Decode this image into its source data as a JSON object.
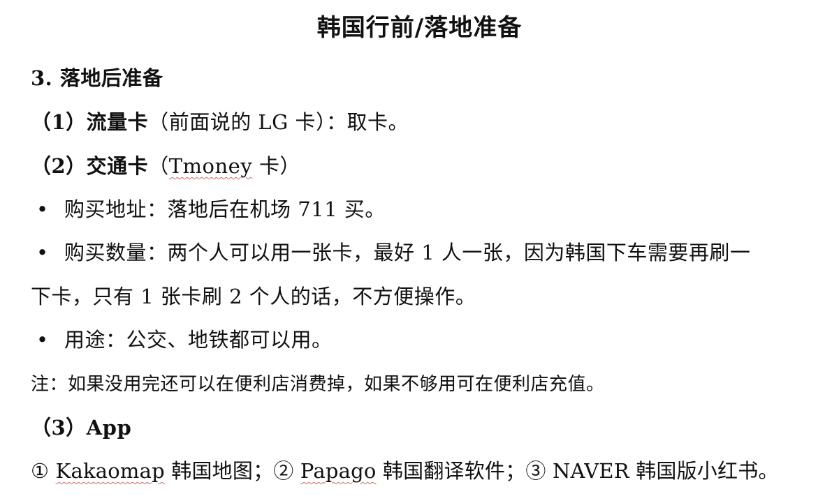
{
  "title": "韩国行前/落地准备",
  "section": {
    "heading": "3. 落地后准备"
  },
  "item1": {
    "label": "（1）流量卡",
    "rest": "（前面说的 LG 卡）：取卡。"
  },
  "item2": {
    "label": "（2）交通卡",
    "paren_open": "（",
    "term": "Tmoney",
    "paren_close": " 卡）"
  },
  "bullets": {
    "symbol": "•",
    "b1": "购买地址：落地后在机场 711 买。",
    "b2_line1": "购买数量：两个人可以用一张卡，最好 1 人一张，因为韩国下车需要再刷一",
    "b2_line2": "下卡，只有 1 张卡刷 2 个人的话，不方便操作。",
    "b3": "用途：公交、地铁都可以用。"
  },
  "note": "注：如果没用完还可以在便利店消费掉，如果不够用可在便利店充值。",
  "item3": {
    "label": "（3）App"
  },
  "apps": {
    "n1": "①",
    "app1": "Kakaomap",
    "desc1": "韩国地图；",
    "n2": "②",
    "app2": "Papago",
    "desc2": "韩国翻译软件；",
    "n3": "③",
    "app3": "NAVER",
    "desc3": "韩国版小红书。"
  }
}
